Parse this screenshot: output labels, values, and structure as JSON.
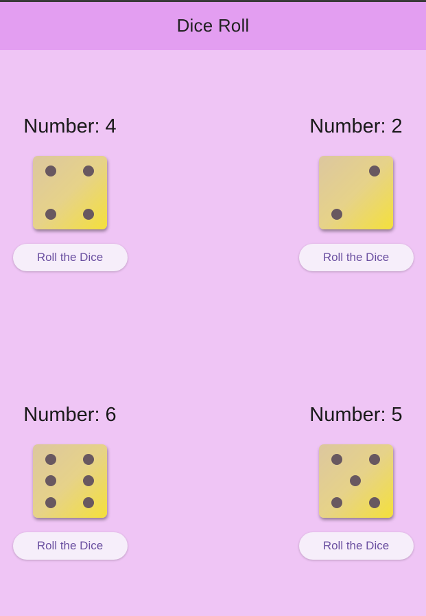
{
  "app": {
    "title": "Dice Roll"
  },
  "dice": [
    {
      "label": "Number: 4",
      "value": 4,
      "button_label": "Roll the Dice"
    },
    {
      "label": "Number: 2",
      "value": 2,
      "button_label": "Roll the Dice"
    },
    {
      "label": "Number: 6",
      "value": 6,
      "button_label": "Roll the Dice"
    },
    {
      "label": "Number: 5",
      "value": 5,
      "button_label": "Roll the Dice"
    }
  ],
  "colors": {
    "background": "#efc5f5",
    "appbar": "#e39ef1",
    "pip": "#685860",
    "button_text": "#6a4fa0"
  },
  "icons": {
    "die_face": "dice-face-icon",
    "pip": "dice-pip-icon"
  }
}
